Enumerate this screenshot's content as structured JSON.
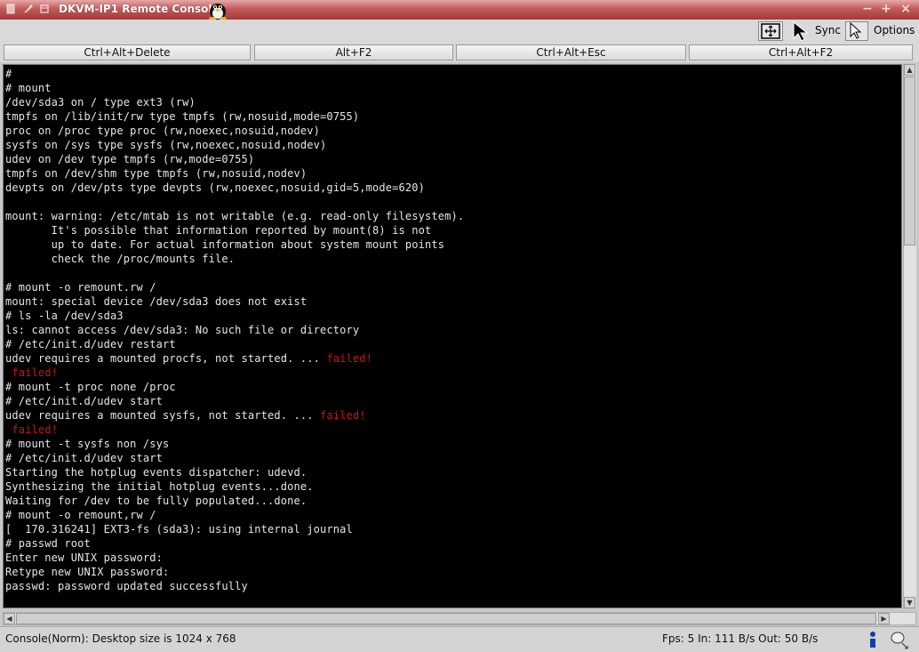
{
  "window": {
    "title": "DKVM-IP1 Remote Console"
  },
  "toolbar": {
    "sync_label": "Sync",
    "options_label": "Options"
  },
  "keys": [
    "Ctrl+Alt+Delete",
    "Alt+F2",
    "Ctrl+Alt+Esc",
    "Ctrl+Alt+F2"
  ],
  "console": {
    "lines": [
      "#",
      "# mount",
      "/dev/sda3 on / type ext3 (rw)",
      "tmpfs on /lib/init/rw type tmpfs (rw,nosuid,mode=0755)",
      "proc on /proc type proc (rw,noexec,nosuid,nodev)",
      "sysfs on /sys type sysfs (rw,noexec,nosuid,nodev)",
      "udev on /dev type tmpfs (rw,mode=0755)",
      "tmpfs on /dev/shm type tmpfs (rw,nosuid,nodev)",
      "devpts on /dev/pts type devpts (rw,noexec,nosuid,gid=5,mode=620)",
      "",
      "mount: warning: /etc/mtab is not writable (e.g. read-only filesystem).",
      "       It's possible that information reported by mount(8) is not",
      "       up to date. For actual information about system mount points",
      "       check the /proc/mounts file.",
      "",
      "# mount -o remount.rw /",
      "mount: special device /dev/sda3 does not exist",
      "# ls -la /dev/sda3",
      "ls: cannot access /dev/sda3: No such file or directory",
      "# /etc/init.d/udev restart",
      "udev requires a mounted procfs, not started. ... ",
      "",
      "# mount -t proc none /proc",
      "# /etc/init.d/udev start",
      "udev requires a mounted sysfs, not started. ... ",
      "",
      "# mount -t sysfs non /sys",
      "# /etc/init.d/udev start",
      "Starting the hotplug events dispatcher: udevd.",
      "Synthesizing the initial hotplug events...done.",
      "Waiting for /dev to be fully populated...done.",
      "# mount -o remount,rw /",
      "[  170.316241] EXT3-fs (sda3): using internal journal",
      "# passwd root",
      "Enter new UNIX password:",
      "Retype new UNIX password:",
      "passwd: password updated successfully",
      "",
      "#"
    ],
    "failed_text": "failed!",
    "failed_indent": " failed!"
  },
  "status": {
    "left": "Console(Norm): Desktop size is 1024 x 768",
    "right": "Fps: 5 In: 111 B/s Out: 50 B/s"
  },
  "colors": {
    "title_bar": "#b84848",
    "console_bg": "#000000",
    "console_fg": "#e6e6e6",
    "failed": "#c01818"
  }
}
